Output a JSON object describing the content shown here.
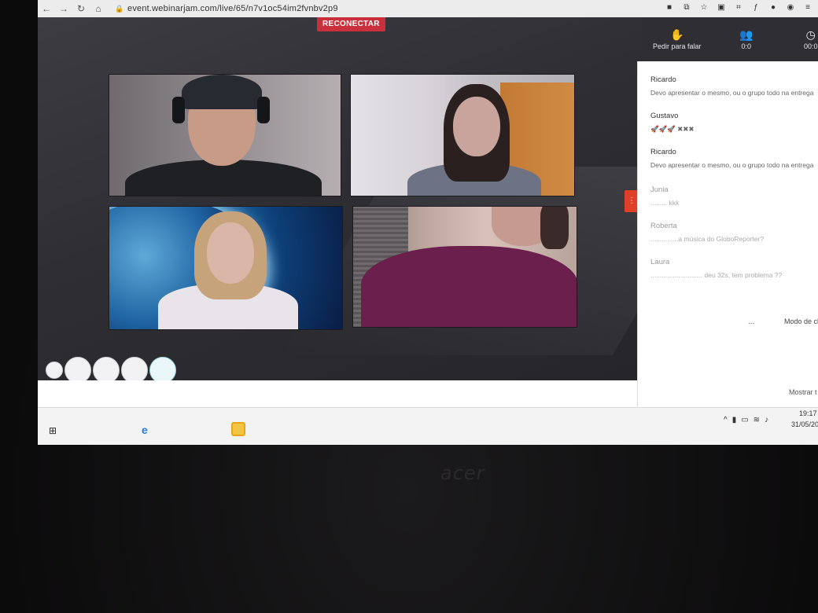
{
  "browser": {
    "url": "event.webinarjam.com/live/65/n7v1oc54im2fvnbv2p9"
  },
  "stage": {
    "reconnect_label": "RECONECTAR"
  },
  "header": {
    "raise_hand_label": "Pedir para falar",
    "attendees_count": "0:0",
    "timer": "00:0"
  },
  "chat": {
    "messages": [
      {
        "author": "Ricardo",
        "text": "Devo apresentar o mesmo, ou o grupo todo na entrega",
        "faded": false
      },
      {
        "author": "Gustavo",
        "text": "🚀🚀🚀 ✖✖✖",
        "faded": false
      },
      {
        "author": "Ricardo",
        "text": "Devo apresentar o mesmo, ou o grupo todo na entrega",
        "faded": false
      },
      {
        "author": "Junia",
        "text": "......... kkk",
        "faded": true
      },
      {
        "author": "Roberta",
        "text": "...............a música do GloboReporter?",
        "faded": true
      },
      {
        "author": "Laura",
        "text": "............................ deu 32s, tem problema ??",
        "faded": true
      }
    ],
    "mode_label": "Modo de ch",
    "more_label": "...",
    "show_label": "Mostrar t"
  },
  "taskbar": {
    "time": "19:17",
    "date": "31/05/20"
  },
  "monitor": {
    "brand": "acer"
  }
}
